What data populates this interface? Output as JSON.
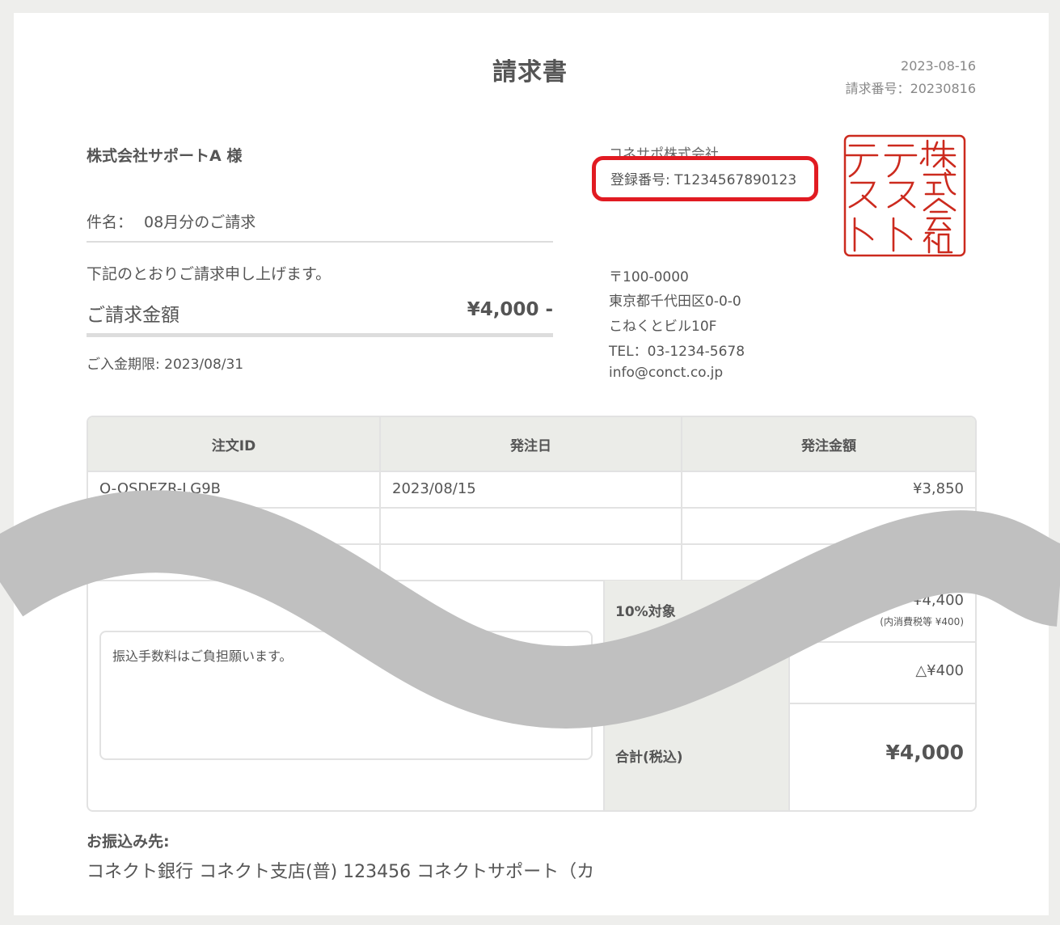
{
  "invoice": {
    "title": "請求書",
    "date": "2023-08-16",
    "number_label": "請求番号：",
    "number": "20230816",
    "client": "株式会社サポートA 様",
    "subject_label": "件名：",
    "subject": "08月分のご請求",
    "intro": "下記のとおりご請求申し上げます。",
    "amount_label": "ご請求金額",
    "amount": "¥4,000 -",
    "due_label": "ご入金期限: ",
    "due": "2023/08/31"
  },
  "issuer": {
    "name": "コネサポ株式会社",
    "registration_label": "登録番号: ",
    "registration": "T1234567890123",
    "postal": "〒100-0000",
    "address": "東京都千代田区0-0-0",
    "building": "こねくとビル10F",
    "tel": "TEL：03-1234-5678",
    "email": "info@conct.co.jp",
    "seal_text": "株式会社テストテスト",
    "seal_color": "#cc2a1e",
    "highlight_color": "#e11b22"
  },
  "table": {
    "headers": [
      "注文ID",
      "発注日",
      "発注金額"
    ],
    "rows": [
      {
        "id": "O-QSDFZR-LG9B",
        "date": "2023/08/15",
        "amount": "¥3,850"
      }
    ]
  },
  "summary": {
    "tax_label": "10%対象",
    "tax_amount": "¥4,400",
    "tax_note": "(内消費税等 ¥400)",
    "adjust_amount": "△¥400",
    "total_label": "合計(税込)",
    "total_amount": "¥4,000"
  },
  "note": "振込手数料はご負担願います。",
  "bank": {
    "label": "お振込み先:",
    "value": "コネクト銀行 コネクト支店(普) 123456 コネクトサポート（カ"
  }
}
